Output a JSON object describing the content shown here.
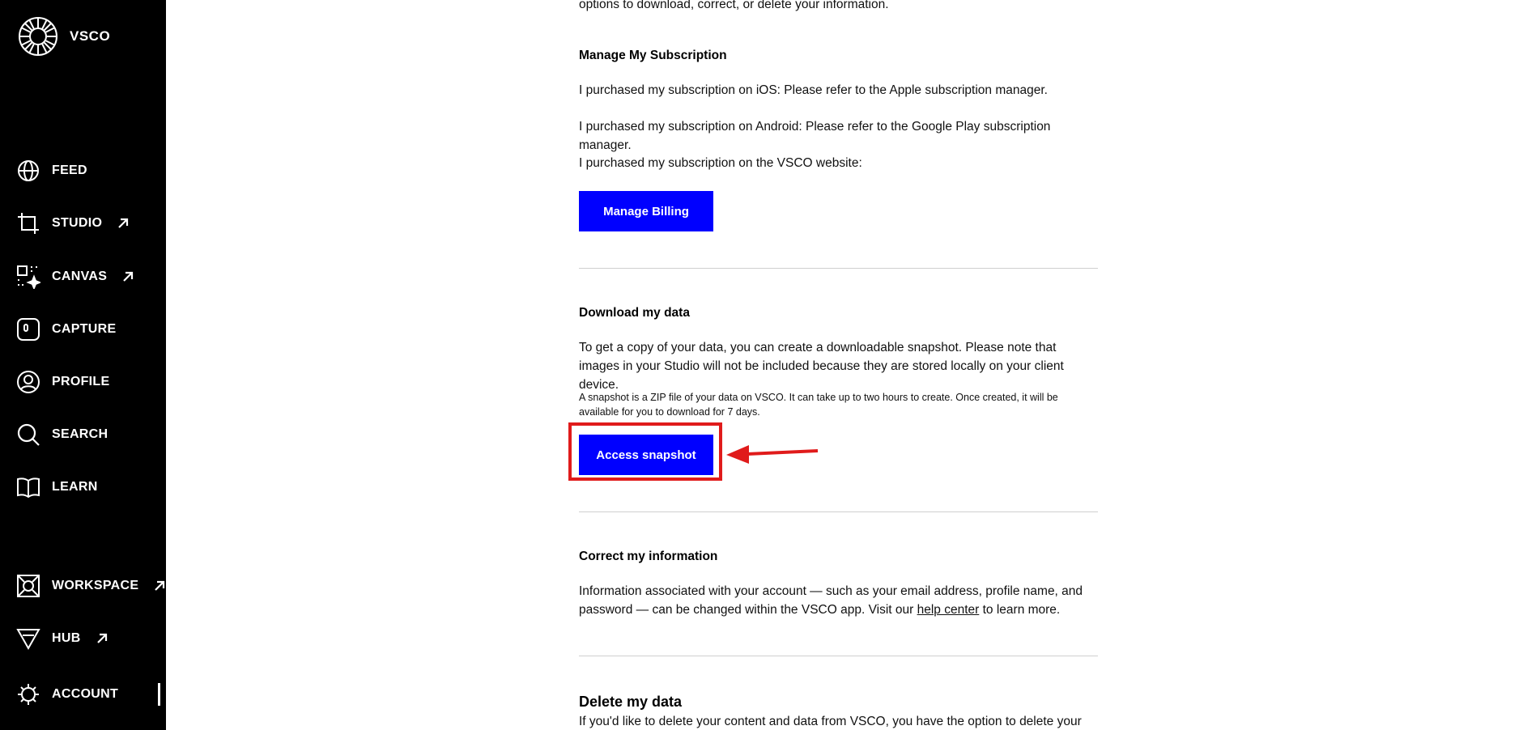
{
  "brand": {
    "name": "VSCO"
  },
  "nav": {
    "feed": "FEED",
    "studio": "STUDIO",
    "canvas": "CANVAS",
    "capture": "CAPTURE",
    "profile": "PROFILE",
    "search": "SEARCH",
    "learn": "LEARN",
    "workspace": "WORKSPACE",
    "hub": "HUB",
    "account": "ACCOUNT"
  },
  "intro_tail": "options to download, correct, or delete your information.",
  "subscription": {
    "heading": "Manage My Subscription",
    "ios": "I purchased my subscription on iOS: Please refer to the Apple subscription manager.",
    "android": "I purchased my subscription on Android: Please refer to the Google Play subscription manager.",
    "web": "I purchased my subscription on the VSCO website:",
    "button": "Manage Billing"
  },
  "download": {
    "heading": "Download my data",
    "body": "To get a copy of your data, you can create a downloadable snapshot. Please note that images in your Studio will not be included because they are stored locally on your client device.",
    "note": "A snapshot is a ZIP file of your data on VSCO. It can take up to two hours to create. Once created, it will be available for you to download for 7 days.",
    "button": "Access snapshot"
  },
  "correct": {
    "heading": "Correct my information",
    "body_before": "Information associated with your account — such as your email address, profile name, and password — can be changed within the VSCO app. Visit our",
    "link": "help center",
    "body_after": "to learn more."
  },
  "delete": {
    "heading": "Delete my data",
    "body": "If you'd like to delete your content and data from VSCO, you have the option to delete your"
  },
  "colors": {
    "accent": "#0000ff",
    "annotation": "#e01b1b",
    "sidebar": "#000000"
  }
}
